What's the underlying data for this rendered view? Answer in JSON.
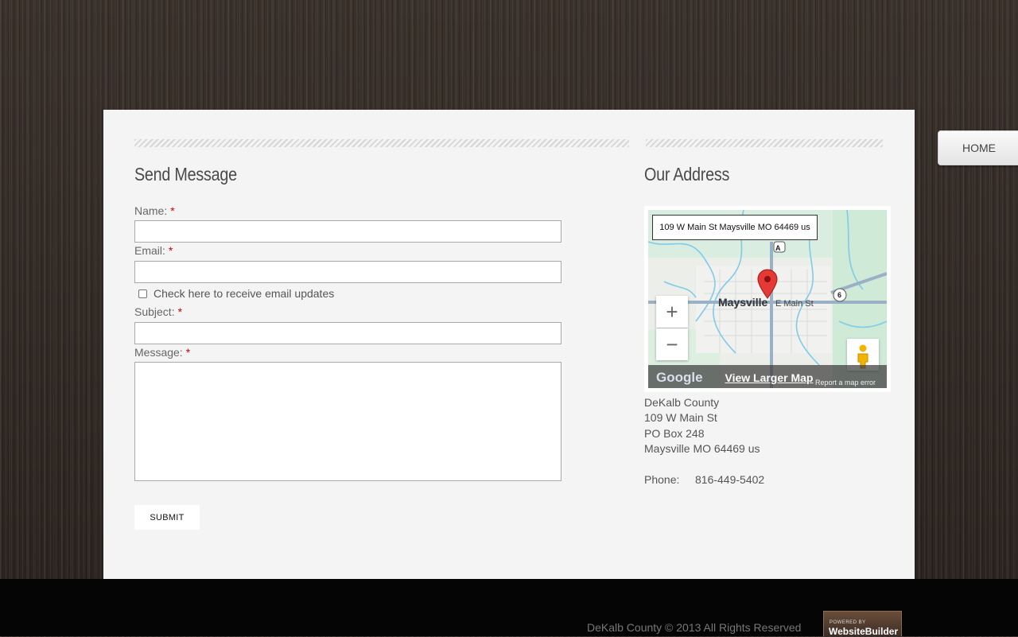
{
  "nav": {
    "home_label": "HOME"
  },
  "send_message": {
    "title": "Send Message",
    "name_label": "Name:",
    "email_label": "Email:",
    "updates_checkbox_label": "Check here to receive email updates",
    "updates_checked": false,
    "subject_label": "Subject:",
    "message_label": "Message:",
    "required_mark": "*",
    "submit_label": "SUBMIT"
  },
  "address": {
    "title": "Our Address",
    "map": {
      "info_text": "109 W Main St Maysville MO 64469 us",
      "town_label": "Maysville",
      "street_label": "E Main St",
      "route_a": "A",
      "route_6": "6",
      "zoom_in": "+",
      "zoom_out": "−",
      "view_larger": "View Larger Map",
      "report_error": "Report a map error",
      "logo": "Google"
    },
    "lines": [
      "DeKalb County",
      "109 W Main St",
      "PO Box 248",
      "Maysville MO 64469 us"
    ],
    "phone_label": "Phone:",
    "phone": "816-449-5402"
  },
  "footer": {
    "copyright": "DeKalb County © 2013 All Rights Reserved",
    "badge_small": "POWERED BY",
    "badge_big": "WebsiteBuilder"
  },
  "colors": {
    "panel": "#f4f4f4",
    "required": "#cc0000",
    "map_pin": "#e53935",
    "footer": "#050505"
  }
}
